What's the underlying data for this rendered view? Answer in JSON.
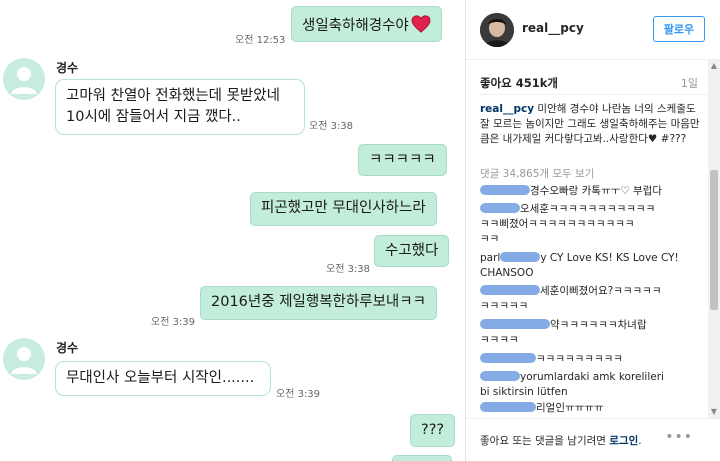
{
  "chat": {
    "messages": [
      {
        "side": "out",
        "text": "생일축하해경수야",
        "heart": "heart-emoji",
        "time": "오전 12:53"
      },
      {
        "side": "in",
        "sender": "경수",
        "lines": [
          "고마워 찬열아 전화했는데 못받았네",
          "10시에 잠들어서 지금 깼다.."
        ],
        "time": "오전 3:38"
      },
      {
        "side": "out",
        "text": "ㅋㅋㅋㅋㅋ"
      },
      {
        "side": "out",
        "text": "피곤했고만 무대인사하느라"
      },
      {
        "side": "out",
        "text": "수고했다",
        "time": "오전 3:38"
      },
      {
        "side": "out",
        "text": "2016년중 제일행복한하루보내ㅋㅋ",
        "time": "오전 3:39"
      },
      {
        "side": "in",
        "sender": "경수",
        "lines": [
          "무대인사 오늘부터 시작인......."
        ],
        "time": "오전 3:39"
      },
      {
        "side": "out",
        "text": "???"
      }
    ],
    "colors": {
      "outgoing_bubble": "#c2eddb",
      "incoming_border": "#b7e3d3",
      "avatar_bg": "#c6ede0"
    }
  },
  "instagram": {
    "username": "real__pcy",
    "follow_label": "팔로우",
    "likes": "좋아요 451k개",
    "post_age": "1일",
    "caption_user": "real__pcy",
    "caption_text": " 미안해 경수야 나란놈 너의 스케줄도 잘 모르는 놈이지만 그래도 생일축하해주는 마음만큼은 내가제일 커다랗다고봐..사랑한다♥ #???",
    "more_comments": "댓글 34,865개 모두 보기",
    "comments": [
      {
        "text": "경수오빠랑 카톡ㅠㅜ♡ 부럽다"
      },
      {
        "text": "오세훈ㅋㅋㅋㅋㅋㅋㅋㅋㅋㅋㅋ",
        "text2": "ㅋㅋ삐졌어ㅋㅋㅋㅋㅋㅋㅋㅋㅋㅋㅋ",
        "text3": "ㅋㅋ"
      },
      {
        "prefix": "parl",
        "text": "y CY Love KS! KS Love CY!",
        "text2": "CHANSOO"
      },
      {
        "text": "세훈이삐졌어요?ㅋㅋㅋㅋㅋ",
        "text2": "ㅋㅋㅋㅋㅋ"
      },
      {
        "text": "약ㅋㅋㅋㅋㅋㅋ차녀랍",
        "text2": "ㅋㅋㅋㅋ"
      },
      {
        "text": "ㅋㅋㅋㅋㅋㅋㅋㅋㅋ"
      },
      {
        "text": "yorumlardaki amk koreli̇leri̇",
        "text2": "bi̇ si̇kti̇rsi̇n lütfen"
      },
      {
        "text": "리얼인ㅠㅠㅠㅠ"
      }
    ],
    "footer_text": "좋아요 또는 댓글을 남기려면 ",
    "footer_link": "로그인",
    "footer_end": ".",
    "more_icon": "more-dots-icon",
    "colors": {
      "follow": "#3897f0",
      "link": "#003569",
      "redaction": "#7ea7e6"
    }
  }
}
